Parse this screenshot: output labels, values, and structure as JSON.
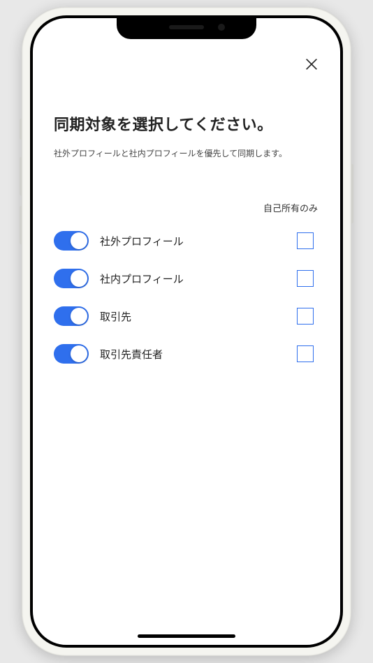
{
  "title": "同期対象を選択してください。",
  "subtitle": "社外プロフィールと社内プロフィールを優先して同期します。",
  "column_header": "自己所有のみ",
  "options": [
    {
      "label": "社外プロフィール",
      "enabled": true,
      "own_only": false
    },
    {
      "label": "社内プロフィール",
      "enabled": true,
      "own_only": false
    },
    {
      "label": "取引先",
      "enabled": true,
      "own_only": false
    },
    {
      "label": "取引先責任者",
      "enabled": true,
      "own_only": false
    }
  ]
}
